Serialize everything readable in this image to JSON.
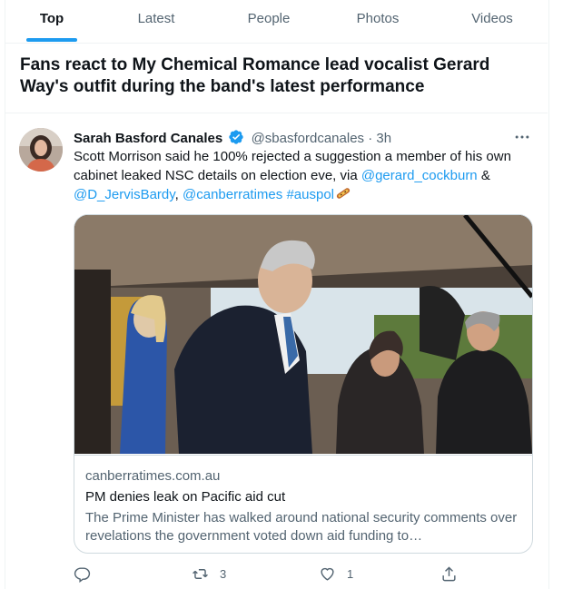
{
  "tabs": [
    "Top",
    "Latest",
    "People",
    "Photos",
    "Videos"
  ],
  "active_tab": "Top",
  "headline": "Fans react to My Chemical Romance lead vocalist Gerard Way's outfit during the band's latest performance",
  "tweet": {
    "author_name": "Sarah Basford Canales",
    "handle": "@sbasfordcanales",
    "separator": "·",
    "time": "3h",
    "verified": true,
    "more_icon": "more-icon",
    "text_plain_1": "Scott Morrison said he 100% rejected a suggestion a member of his own cabinet leaked NSC details on election eve, via ",
    "mention_1": "@gerard_cockburn",
    "text_plain_2": " & ",
    "mention_2": "@D_JervisBardy",
    "text_plain_3": ", ",
    "mention_3": "@canberratimes",
    "text_plain_4": " ",
    "hashtag": "#auspol",
    "emoji_icon": "snowboard-emoji-icon"
  },
  "card": {
    "domain": "canberratimes.com.au",
    "title": "PM denies leak on Pacific aid cut",
    "description": "The Prime Minister has walked around national security comments over revelations the government voted down aid funding to…"
  },
  "actions": {
    "reply_count": "",
    "retweet_count": "3",
    "like_count": "1"
  },
  "colors": {
    "accent": "#1d9bf0",
    "secondary_text": "#536471",
    "border": "#eff3f4"
  }
}
